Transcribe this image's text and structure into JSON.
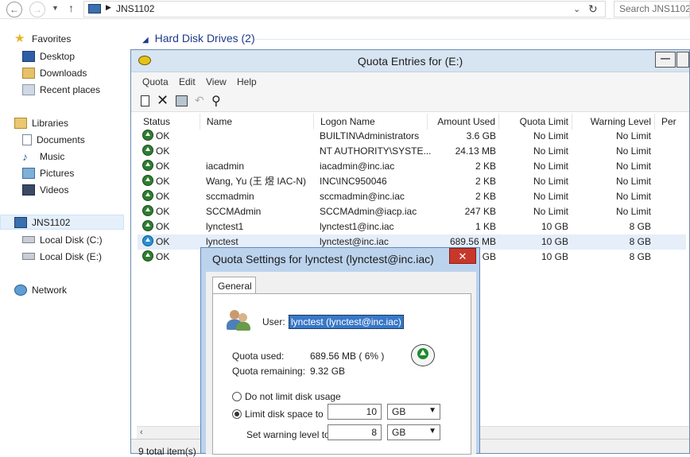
{
  "address": {
    "path": "JNS1102",
    "search_placeholder": "Search JNS1102"
  },
  "sidebar": {
    "favorites": "Favorites",
    "fav_items": [
      "Desktop",
      "Downloads",
      "Recent places"
    ],
    "libraries": "Libraries",
    "lib_items": [
      "Documents",
      "Music",
      "Pictures",
      "Videos"
    ],
    "computer": "JNS1102",
    "drives": [
      "Local Disk (C:)",
      "Local Disk (E:)"
    ],
    "network": "Network"
  },
  "section_title": "Hard Disk Drives (2)",
  "quota_window": {
    "title": "Quota Entries for  (E:)",
    "menu": [
      "Quota",
      "Edit",
      "View",
      "Help"
    ],
    "columns": [
      "Status",
      "Name",
      "Logon Name",
      "Amount Used",
      "Quota Limit",
      "Warning Level",
      "Per"
    ],
    "rows": [
      {
        "status": "OK",
        "name": "",
        "logon": "BUILTIN\\Administrators",
        "used": "3.6 GB",
        "limit": "No Limit",
        "warn": "No Limit"
      },
      {
        "status": "OK",
        "name": "",
        "logon": "NT AUTHORITY\\SYSTE...",
        "used": "24.13 MB",
        "limit": "No Limit",
        "warn": "No Limit"
      },
      {
        "status": "OK",
        "name": "iacadmin",
        "logon": "iacadmin@inc.iac",
        "used": "2 KB",
        "limit": "No Limit",
        "warn": "No Limit"
      },
      {
        "status": "OK",
        "name": "Wang, Yu (王 煜 IAC-N)",
        "logon": "INC\\INC950046",
        "used": "2 KB",
        "limit": "No Limit",
        "warn": "No Limit"
      },
      {
        "status": "OK",
        "name": "sccmadmin",
        "logon": "sccmadmin@inc.iac",
        "used": "2 KB",
        "limit": "No Limit",
        "warn": "No Limit"
      },
      {
        "status": "OK",
        "name": "SCCMAdmin",
        "logon": "SCCMAdmin@iacp.iac",
        "used": "247 KB",
        "limit": "No Limit",
        "warn": "No Limit"
      },
      {
        "status": "OK",
        "name": "lynctest1",
        "logon": "lynctest1@inc.iac",
        "used": "1 KB",
        "limit": "10 GB",
        "warn": "8 GB"
      },
      {
        "status": "OK",
        "name": "lynctest",
        "logon": "lynctest@inc.iac",
        "used": "689.56 MB",
        "limit": "10 GB",
        "warn": "8 GB"
      },
      {
        "status": "OK",
        "name": "",
        "logon": "",
        "used": "GB",
        "limit": "10 GB",
        "warn": "8 GB"
      }
    ],
    "status_text": "9 total item(s)"
  },
  "dialog": {
    "title": "Quota Settings for lynctest (lynctest@inc.iac)",
    "close": "✕",
    "tab": "General",
    "user_label": "User:",
    "user_value": "lynctest (lynctest@inc.iac)",
    "used_label": "Quota used:",
    "used_value": "689.56 MB ( 6% )",
    "remaining_label": "Quota remaining:",
    "remaining_value": "9.32 GB",
    "no_limit_label": "Do not limit disk usage",
    "limit_label": "Limit disk space to",
    "limit_value": "10",
    "limit_unit": "GB",
    "warn_label": "Set warning level to",
    "warn_value": "8",
    "warn_unit": "GB"
  }
}
